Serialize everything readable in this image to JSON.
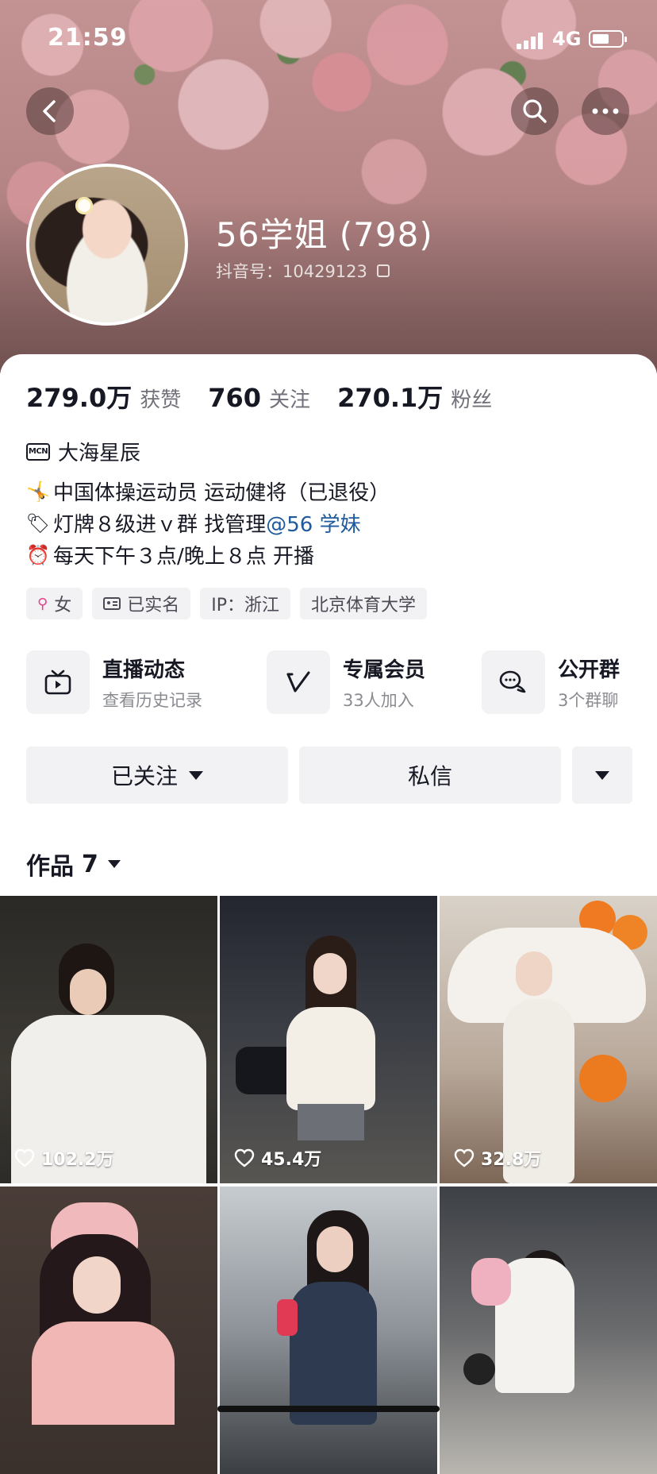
{
  "status_bar": {
    "time": "21:59",
    "network": "4G"
  },
  "profile": {
    "name": "56学姐 (798)",
    "douyin_id": "抖音号：10429123"
  },
  "stats": [
    {
      "value": "279.0万",
      "label": "获赞"
    },
    {
      "value": "760",
      "label": "关注"
    },
    {
      "value": "270.1万",
      "label": "粉丝"
    }
  ],
  "mcn": {
    "badge": "MCN",
    "name": "大海星辰"
  },
  "bio": {
    "line1": {
      "emoji": "🤸",
      "text": "中国体操运动员 运动健将（已退役）"
    },
    "line2": {
      "emoji": "🏷",
      "text": "灯牌８级进ｖ群 找管理 ",
      "mention": "@56 学妹"
    },
    "line3": {
      "emoji": "⏰",
      "text": "每天下午３点/晚上８点 开播"
    }
  },
  "tags": [
    {
      "icon": "female-icon",
      "text": "女"
    },
    {
      "icon": "id-card-icon",
      "text": "已实名"
    },
    {
      "icon": "",
      "text": "IP：浙江"
    },
    {
      "icon": "",
      "text": "北京体育大学"
    }
  ],
  "features": [
    {
      "icon": "live-tv-icon",
      "title": "直播动态",
      "subtitle": "查看历史记录"
    },
    {
      "icon": "vip-v-icon",
      "title": "专属会员",
      "subtitle": "33人加入"
    },
    {
      "icon": "group-chat-icon",
      "title": "公开群",
      "subtitle": "3个群聊"
    }
  ],
  "actions": {
    "follow": "已关注",
    "message": "私信"
  },
  "works": {
    "label": "作品",
    "count": "7"
  },
  "videos": [
    {
      "likes": "102.2万"
    },
    {
      "likes": "45.4万"
    },
    {
      "likes": "32.8万"
    },
    {
      "likes": ""
    },
    {
      "likes": ""
    },
    {
      "likes": ""
    }
  ],
  "colors": {
    "mention": "#1f5a9c",
    "chip_bg": "#f2f2f4",
    "text_primary": "#161823",
    "text_secondary": "#70717a"
  }
}
